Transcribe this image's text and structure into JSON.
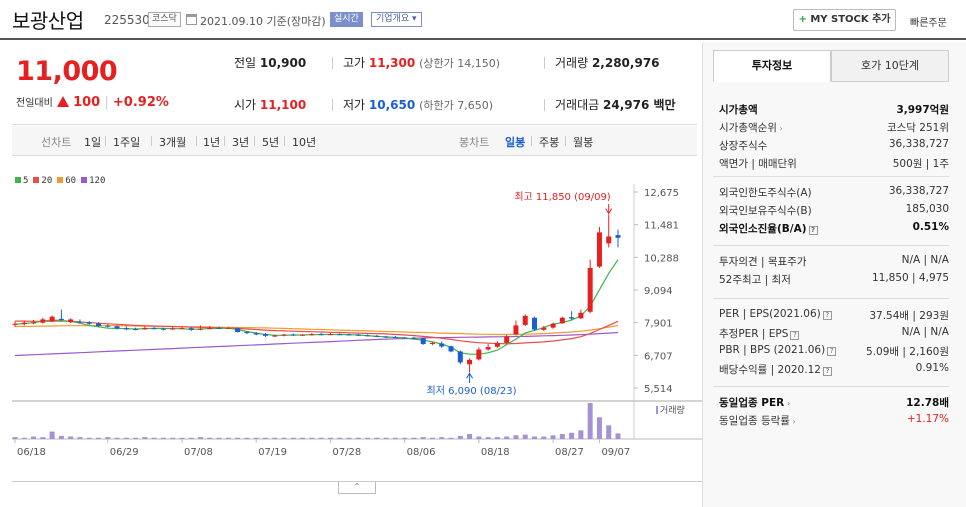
{
  "header": {
    "company_name": "보광산업",
    "code": "225530",
    "market_badge": "코스닥",
    "date_info": "2021.09.10 기준(장마감)",
    "realtime_badge": "실시간",
    "company_overview_button": "기업개요 ▾",
    "mystock_button": "MY STOCK 추가",
    "mystock_plus": "+",
    "quick_order": "빠른주문"
  },
  "summary": {
    "price": "11,000",
    "change_label": "전일대비",
    "change_amount": "100",
    "change_pct": "+0.92%",
    "prev_close_label": "전일",
    "prev_close": "10,900",
    "high_label": "고가",
    "high": "11,300",
    "upper_limit": "(상한가 14,150)",
    "volume_label": "거래량",
    "volume": "2,280,976",
    "open_label": "시가",
    "open": "11,100",
    "low_label": "저가",
    "low": "10,650",
    "lower_limit": "(하한가 7,650)",
    "amount_label": "거래대금",
    "amount": "24,976 백만"
  },
  "periods": {
    "line_label": "선차트",
    "line_items": [
      "1일",
      "1주일",
      "3개월",
      "1년",
      "3년",
      "5년",
      "10년"
    ],
    "candle_label": "봉차트",
    "candle_items": [
      "일봉",
      "주봉",
      "월봉"
    ],
    "active_candle": "일봉"
  },
  "chart_data": {
    "type": "candlestick",
    "legend": [
      {
        "name": "5",
        "color": "#3cb449"
      },
      {
        "name": "20",
        "color": "#e84e4e"
      },
      {
        "name": "60",
        "color": "#f39a2c"
      },
      {
        "name": "120",
        "color": "#9b59d0"
      }
    ],
    "y_ticks": [
      "12,675",
      "11,481",
      "10,288",
      "9,094",
      "7,901",
      "6,707",
      "5,514"
    ],
    "ylim": [
      5514,
      12675
    ],
    "x_labels": [
      "06/18",
      "06/29",
      "07/08",
      "07/19",
      "07/28",
      "08/06",
      "08/18",
      "08/27",
      "09/07"
    ],
    "high_annotation": "최고 11,850 (09/09)",
    "low_annotation": "최저 6,090 (08/23)",
    "volume_label": "거래량",
    "candles": [
      {
        "o": 7820,
        "c": 7860,
        "h": 7950,
        "l": 7750
      },
      {
        "o": 7850,
        "c": 7900,
        "h": 7980,
        "l": 7800
      },
      {
        "o": 7880,
        "c": 7910,
        "h": 8000,
        "l": 7850
      },
      {
        "o": 7900,
        "c": 8020,
        "h": 8080,
        "l": 7870
      },
      {
        "o": 7950,
        "c": 8120,
        "h": 8160,
        "l": 7920
      },
      {
        "o": 8040,
        "c": 8000,
        "h": 8380,
        "l": 7980
      },
      {
        "o": 7920,
        "c": 8020,
        "h": 8060,
        "l": 7890
      },
      {
        "o": 7940,
        "c": 7910,
        "h": 8020,
        "l": 7870
      },
      {
        "o": 7920,
        "c": 7860,
        "h": 7960,
        "l": 7820
      },
      {
        "o": 7870,
        "c": 7780,
        "h": 7920,
        "l": 7740
      },
      {
        "o": 7790,
        "c": 7760,
        "h": 7840,
        "l": 7720
      },
      {
        "o": 7770,
        "c": 7690,
        "h": 7800,
        "l": 7650
      },
      {
        "o": 7700,
        "c": 7660,
        "h": 7760,
        "l": 7630
      },
      {
        "o": 7670,
        "c": 7660,
        "h": 7720,
        "l": 7620
      },
      {
        "o": 7660,
        "c": 7710,
        "h": 7760,
        "l": 7640
      },
      {
        "o": 7700,
        "c": 7680,
        "h": 7740,
        "l": 7650
      },
      {
        "o": 7680,
        "c": 7650,
        "h": 7720,
        "l": 7620
      },
      {
        "o": 7660,
        "c": 7690,
        "h": 7740,
        "l": 7640
      },
      {
        "o": 7690,
        "c": 7700,
        "h": 7760,
        "l": 7660
      },
      {
        "o": 7700,
        "c": 7640,
        "h": 7730,
        "l": 7600
      },
      {
        "o": 7650,
        "c": 7680,
        "h": 7800,
        "l": 7620
      },
      {
        "o": 7690,
        "c": 7710,
        "h": 7780,
        "l": 7660
      },
      {
        "o": 7710,
        "c": 7700,
        "h": 7760,
        "l": 7680
      },
      {
        "o": 7700,
        "c": 7710,
        "h": 7740,
        "l": 7680
      },
      {
        "o": 7700,
        "c": 7560,
        "h": 7720,
        "l": 7540
      },
      {
        "o": 7560,
        "c": 7520,
        "h": 7590,
        "l": 7480
      },
      {
        "o": 7520,
        "c": 7470,
        "h": 7560,
        "l": 7440
      },
      {
        "o": 7480,
        "c": 7420,
        "h": 7520,
        "l": 7380
      },
      {
        "o": 7420,
        "c": 7430,
        "h": 7460,
        "l": 7380
      },
      {
        "o": 7430,
        "c": 7470,
        "h": 7490,
        "l": 7400
      },
      {
        "o": 7470,
        "c": 7440,
        "h": 7500,
        "l": 7410
      },
      {
        "o": 7440,
        "c": 7460,
        "h": 7480,
        "l": 7420
      },
      {
        "o": 7460,
        "c": 7480,
        "h": 7520,
        "l": 7430
      },
      {
        "o": 7480,
        "c": 7470,
        "h": 7520,
        "l": 7440
      },
      {
        "o": 7470,
        "c": 7480,
        "h": 7520,
        "l": 7450
      },
      {
        "o": 7480,
        "c": 7470,
        "h": 7510,
        "l": 7450
      },
      {
        "o": 7470,
        "c": 7460,
        "h": 7500,
        "l": 7440
      },
      {
        "o": 7460,
        "c": 7440,
        "h": 7490,
        "l": 7420
      },
      {
        "o": 7440,
        "c": 7420,
        "h": 7470,
        "l": 7400
      },
      {
        "o": 7420,
        "c": 7390,
        "h": 7450,
        "l": 7370
      },
      {
        "o": 7390,
        "c": 7380,
        "h": 7420,
        "l": 7350
      },
      {
        "o": 7380,
        "c": 7360,
        "h": 7410,
        "l": 7340
      },
      {
        "o": 7360,
        "c": 7350,
        "h": 7380,
        "l": 7330
      },
      {
        "o": 7350,
        "c": 7330,
        "h": 7380,
        "l": 7300
      },
      {
        "o": 7330,
        "c": 7120,
        "h": 7360,
        "l": 7090
      },
      {
        "o": 7120,
        "c": 7160,
        "h": 7200,
        "l": 7080
      },
      {
        "o": 7140,
        "c": 7030,
        "h": 7210,
        "l": 6980
      },
      {
        "o": 7040,
        "c": 6850,
        "h": 7060,
        "l": 6820
      },
      {
        "o": 6850,
        "c": 6450,
        "h": 6880,
        "l": 6380
      },
      {
        "o": 6380,
        "c": 6540,
        "h": 6600,
        "l": 6090
      },
      {
        "o": 6560,
        "c": 6920,
        "h": 7000,
        "l": 6520
      },
      {
        "o": 6920,
        "c": 7010,
        "h": 7120,
        "l": 6880
      },
      {
        "o": 7020,
        "c": 7150,
        "h": 7220,
        "l": 6980
      },
      {
        "o": 7160,
        "c": 7400,
        "h": 7450,
        "l": 7120
      },
      {
        "o": 7470,
        "c": 7800,
        "h": 7980,
        "l": 7440
      },
      {
        "o": 7820,
        "c": 8150,
        "h": 8200,
        "l": 7780
      },
      {
        "o": 8080,
        "c": 7650,
        "h": 8120,
        "l": 7600
      },
      {
        "o": 7640,
        "c": 7720,
        "h": 7780,
        "l": 7600
      },
      {
        "o": 7720,
        "c": 7860,
        "h": 7900,
        "l": 7680
      },
      {
        "o": 7880,
        "c": 8080,
        "h": 8120,
        "l": 7860
      },
      {
        "o": 8100,
        "c": 8050,
        "h": 8320,
        "l": 8020
      },
      {
        "o": 8060,
        "c": 8260,
        "h": 8380,
        "l": 8040
      },
      {
        "o": 8300,
        "c": 9900,
        "h": 10200,
        "l": 8240
      },
      {
        "o": 9950,
        "c": 11200,
        "h": 11400,
        "l": 9900
      },
      {
        "o": 10800,
        "c": 11050,
        "h": 11850,
        "l": 10650
      },
      {
        "o": 11100,
        "c": 11000,
        "h": 11300,
        "l": 10650
      }
    ],
    "ma5": [
      7840,
      7870,
      7900,
      7960,
      8000,
      7980,
      7950,
      7880,
      7800,
      7750,
      7700,
      7690,
      7680,
      7670,
      7680,
      7690,
      7690,
      7680,
      7680,
      7660,
      7670,
      7680,
      7690,
      7700,
      7650,
      7580,
      7520,
      7470,
      7440,
      7440,
      7450,
      7450,
      7460,
      7470,
      7470,
      7470,
      7460,
      7450,
      7430,
      7400,
      7380,
      7360,
      7340,
      7300,
      7260,
      7200,
      7120,
      7000,
      6800,
      6750,
      6750,
      6800,
      6900,
      7100,
      7300,
      7520,
      7620,
      7720,
      7850,
      7900,
      8000,
      8150,
      8500,
      9100,
      9700,
      10200
    ],
    "ma20": [
      7960,
      7960,
      7950,
      7950,
      7960,
      7960,
      7950,
      7930,
      7900,
      7880,
      7860,
      7840,
      7820,
      7800,
      7790,
      7780,
      7770,
      7760,
      7750,
      7740,
      7730,
      7720,
      7710,
      7700,
      7690,
      7670,
      7650,
      7630,
      7610,
      7600,
      7590,
      7580,
      7570,
      7560,
      7550,
      7540,
      7530,
      7520,
      7510,
      7500,
      7490,
      7470,
      7450,
      7430,
      7400,
      7370,
      7330,
      7290,
      7240,
      7200,
      7170,
      7150,
      7140,
      7130,
      7140,
      7160,
      7180,
      7200,
      7230,
      7270,
      7320,
      7390,
      7500,
      7650,
      7800,
      7950
    ],
    "ma60": [
      7760,
      7765,
      7770,
      7775,
      7780,
      7785,
      7790,
      7790,
      7790,
      7790,
      7790,
      7790,
      7785,
      7780,
      7775,
      7770,
      7765,
      7760,
      7755,
      7750,
      7745,
      7740,
      7735,
      7730,
      7725,
      7720,
      7715,
      7710,
      7700,
      7690,
      7680,
      7670,
      7660,
      7650,
      7640,
      7630,
      7620,
      7610,
      7600,
      7590,
      7580,
      7570,
      7560,
      7550,
      7540,
      7530,
      7520,
      7510,
      7500,
      7490,
      7480,
      7475,
      7470,
      7470,
      7475,
      7480,
      7490,
      7500,
      7520,
      7540,
      7560,
      7590,
      7630,
      7680,
      7740,
      7800
    ],
    "ma120": [
      6700,
      6715,
      6730,
      6745,
      6760,
      6775,
      6790,
      6805,
      6820,
      6835,
      6850,
      6865,
      6880,
      6895,
      6910,
      6925,
      6940,
      6955,
      6970,
      6985,
      7000,
      7015,
      7030,
      7045,
      7060,
      7075,
      7090,
      7105,
      7120,
      7135,
      7150,
      7165,
      7180,
      7195,
      7210,
      7225,
      7240,
      7255,
      7270,
      7285,
      7300,
      7310,
      7320,
      7330,
      7340,
      7350,
      7355,
      7360,
      7365,
      7370,
      7375,
      7380,
      7385,
      7390,
      7395,
      7400,
      7410,
      7420,
      7430,
      7440,
      7450,
      7460,
      7480,
      7500,
      7520,
      7540
    ],
    "volumes": [
      3,
      2,
      4,
      3,
      12,
      5,
      4,
      3,
      2,
      2,
      3,
      2,
      2,
      2,
      3,
      2,
      2,
      2,
      2,
      2,
      3,
      2,
      2,
      2,
      2,
      2,
      2,
      2,
      2,
      2,
      2,
      2,
      2,
      2,
      2,
      2,
      2,
      2,
      2,
      2,
      2,
      2,
      2,
      2,
      3,
      2,
      3,
      2,
      5,
      8,
      4,
      3,
      3,
      4,
      6,
      7,
      4,
      4,
      6,
      8,
      10,
      14,
      58,
      35,
      22,
      9
    ]
  },
  "right_panel": {
    "tab_active": "투자정보",
    "tab_other": "호가 10단계",
    "section1": [
      {
        "label": "시가총액",
        "value": "3,997억원",
        "bold": true
      },
      {
        "label": "시가총액순위",
        "value": "코스닥 251위",
        "arrow": true
      },
      {
        "label": "상장주식수",
        "value": "36,338,727"
      },
      {
        "label": "액면가 | 매매단위",
        "value": "500원 | 1주"
      }
    ],
    "section2": [
      {
        "label": "외국인한도주식수(A)",
        "value": "36,338,727"
      },
      {
        "label": "외국인보유주식수(B)",
        "value": "185,030"
      },
      {
        "label": "외국인소진율(B/A)",
        "value": "0.51%",
        "bold": true,
        "q": true
      }
    ],
    "section3": [
      {
        "label": "투자의견 | 목표주가",
        "value": "N/A | N/A"
      },
      {
        "label": "52주최고 | 최저",
        "value": "11,850 | 4,975"
      }
    ],
    "section4": [
      {
        "label": "PER | EPS(2021.06)",
        "value": "37.54배 | 293원",
        "q": true
      },
      {
        "label": "추정PER | EPS",
        "value": "N/A | N/A",
        "q": true
      },
      {
        "label": "PBR | BPS (2021.06)",
        "value": "5.09배 | 2,160원",
        "q": true
      },
      {
        "label": "배당수익률 | 2020.12",
        "value": "0.91%",
        "q": true
      }
    ],
    "section5": [
      {
        "label": "동일업종 PER",
        "value": "12.78배",
        "bold": true,
        "arrow": true
      },
      {
        "label": "동일업종 등락률",
        "value": "+1.17%",
        "red": true,
        "arrow": true
      }
    ]
  },
  "collapse_button": "⌃"
}
